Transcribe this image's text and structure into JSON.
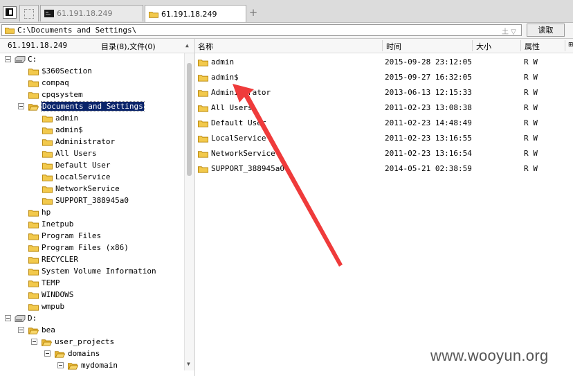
{
  "tabs": [
    {
      "label": ""
    },
    {
      "label": "61.191.18.249"
    },
    {
      "label": "61.191.18.249"
    }
  ],
  "tab_add": "+",
  "address": {
    "path": "C:\\Documents and Settings\\",
    "extra": "土 ▽",
    "read_button": "读取"
  },
  "left_panel": {
    "host": "61.191.18.249",
    "summary": "目录(8),文件(0)"
  },
  "columns": {
    "name": "名称",
    "time": "时间",
    "size": "大小",
    "attr": "属性"
  },
  "tree": {
    "drive_c": "C:",
    "c_items": [
      "$360Section",
      "compaq",
      "cpqsystem",
      "Documents and Settings"
    ],
    "docs_items": [
      "admin",
      "admin$",
      "Administrator",
      "All Users",
      "Default User",
      "LocalService",
      "NetworkService",
      "SUPPORT_388945a0"
    ],
    "c_items_after": [
      "hp",
      "Inetpub",
      "Program Files",
      "Program Files (x86)",
      "RECYCLER",
      "System Volume Information",
      "TEMP",
      "WINDOWS",
      "wmpub"
    ],
    "drive_d": "D:",
    "d_items": [
      "bea",
      "user_projects",
      "domains",
      "mydomain"
    ]
  },
  "files": [
    {
      "name": "admin",
      "time": "2015-09-28 23:12:05",
      "attr": "R W"
    },
    {
      "name": "admin$",
      "time": "2015-09-27 16:32:05",
      "attr": "R W"
    },
    {
      "name": "Administrator",
      "time": "2013-06-13 12:15:33",
      "attr": "R W"
    },
    {
      "name": "All Users",
      "time": "2011-02-23 13:08:38",
      "attr": "R W"
    },
    {
      "name": "Default User",
      "time": "2011-02-23 14:48:49",
      "attr": "R W"
    },
    {
      "name": "LocalService",
      "time": "2011-02-23 13:16:55",
      "attr": "R W"
    },
    {
      "name": "NetworkService",
      "time": "2011-02-23 13:16:54",
      "attr": "R W"
    },
    {
      "name": "SUPPORT_388945a0",
      "time": "2014-05-21 02:38:59",
      "attr": "R W"
    }
  ],
  "watermark": "www.wooyun.org",
  "colors": {
    "arrow": "#ef3b3b",
    "folder": "#f2c94c",
    "selection": "#0a246a"
  }
}
